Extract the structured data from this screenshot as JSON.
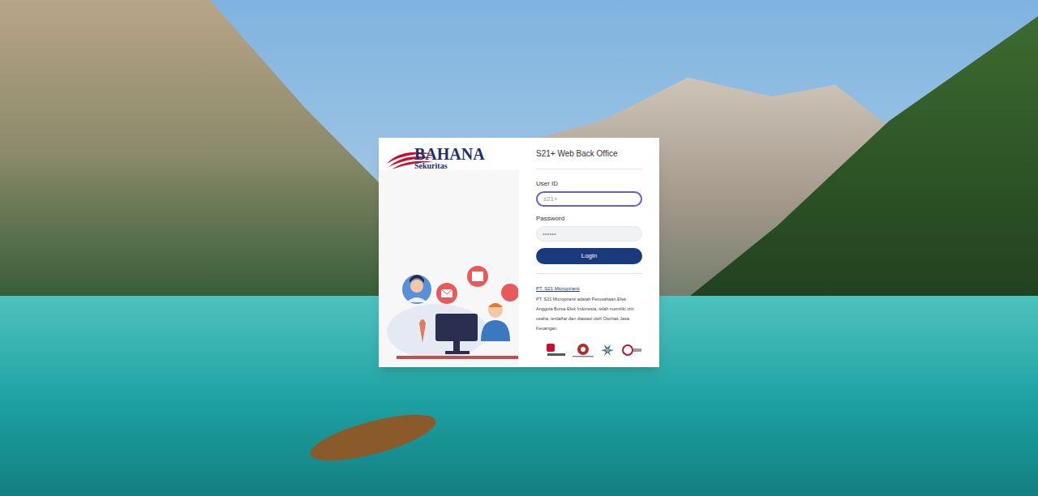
{
  "brand": {
    "name": "BAHANA",
    "subtitle": "Sekuritas"
  },
  "form": {
    "title": "S21+ Web Back Office",
    "fields": [
      {
        "label": "User ID",
        "placeholder": "s21+",
        "focused": true,
        "kind": "text"
      },
      {
        "label": "Password",
        "placeholder": "••••••",
        "focused": false,
        "kind": "password"
      }
    ],
    "button": "Login"
  },
  "footer": {
    "link": "PT. S21 Micropiranti",
    "description": "PT. S21 Micropiranti adalah Perusahaan Efek Anggota Bursa Efek Indonesia, telah memiliki izin usaha, terdaftar dan diawasi oleh Otoritas Jasa Keuangan."
  }
}
